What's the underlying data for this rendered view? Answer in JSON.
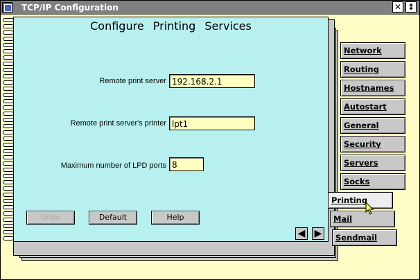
{
  "window": {
    "title": "TCP/IP Configuration",
    "close_glyph": "✕",
    "maximize_glyph": "↕"
  },
  "page": {
    "heading": "Configure Printing Services",
    "fields": [
      {
        "label": "Remote print server",
        "value": "192.168.2.1"
      },
      {
        "label": "Remote print server's printer",
        "value": "lpt1"
      },
      {
        "label": "Maximum number of LPD ports",
        "value": "8"
      }
    ],
    "buttons": {
      "undo": "Undo",
      "default": "Default",
      "help": "Help"
    },
    "prev_page_glyph": "◀",
    "next_page_glyph": "▶"
  },
  "tabs": [
    "Network",
    "Routing",
    "Hostnames",
    "Autostart",
    "General",
    "Security",
    "Servers",
    "Socks",
    "Printing",
    "Mail",
    "Sendmail"
  ],
  "active_tab": "Printing",
  "colors": {
    "page_background": "#b8f0f0",
    "field_background": "#ffffc0",
    "desktop": "#fffdc6",
    "titlebar": "#808080"
  }
}
